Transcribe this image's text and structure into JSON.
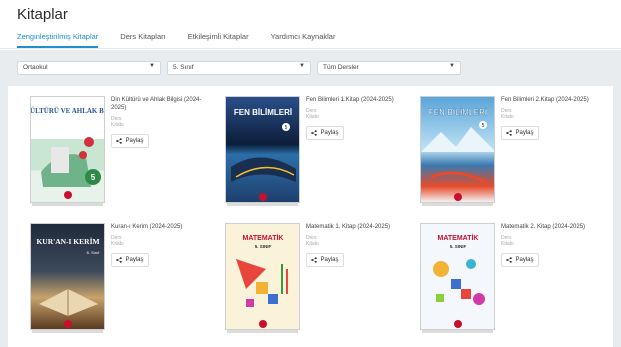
{
  "page_title": "Kitaplar",
  "tabs": [
    {
      "label": "Zenginleştirilmiş Kitaplar",
      "active": true
    },
    {
      "label": "Ders Kitapları",
      "active": false
    },
    {
      "label": "Etkileşimli Kitaplar",
      "active": false
    },
    {
      "label": "Yardımcı Kaynaklar",
      "active": false
    }
  ],
  "filters": {
    "level": "Ortaokul",
    "grade": "5. Sınıf",
    "subject": "Tüm Dersler"
  },
  "share_label": "Paylaş",
  "books": [
    {
      "title": "Din Kültürü ve Ahlak Bilgisi (2024-2025)",
      "type": "Ders Kitabı",
      "cover_heading": "DİN KÜLTÜRÜ VE AHLAK BİLGİSİ",
      "cover_grade": "5"
    },
    {
      "title": "Fen Bilimleri 1.Kitap (2024-2025)",
      "type": "Ders Kitabı",
      "cover_heading": "FEN BİLİMLERİ",
      "cover_grade": "5"
    },
    {
      "title": "Fen Bilimleri 2.Kitap (2024-2025)",
      "type": "Ders Kitabı",
      "cover_heading": "FEN BİLİMLERİ",
      "cover_grade": "5"
    },
    {
      "title": "Kuran-ı Kerim (2024-2025)",
      "type": "Ders Kitabı",
      "cover_heading": "KUR'AN-I KERİM",
      "cover_grade": "5. Sınıf"
    },
    {
      "title": "Matematik 1. Kitap (2024-2025)",
      "type": "Ders Kitabı",
      "cover_heading": "MATEMATİK",
      "cover_grade": "5. SINIF"
    },
    {
      "title": "Matematik 2. Kitap (2024-2025)",
      "type": "Ders Kitabı",
      "cover_heading": "MATEMATİK",
      "cover_grade": "5. SINIF"
    }
  ],
  "colors": {
    "accent": "#1f8fd1",
    "filter_bar": "#e8ecef"
  }
}
